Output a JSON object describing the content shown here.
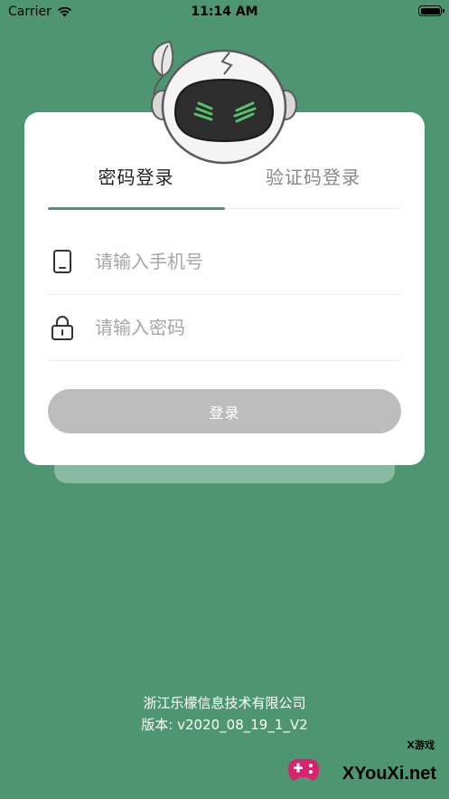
{
  "status_bar": {
    "carrier": "Carrier",
    "time": "11:14 AM"
  },
  "tabs": [
    {
      "label": "密码登录",
      "active": true
    },
    {
      "label": "验证码登录",
      "active": false
    }
  ],
  "fields": {
    "phone": {
      "placeholder": "请输入手机号",
      "value": ""
    },
    "password": {
      "placeholder": "请输入密码",
      "value": ""
    }
  },
  "login_button": {
    "label": "登录"
  },
  "footer": {
    "company": "浙江乐檬信息技术有限公司",
    "version": "版本: v2020_08_19_1_V2"
  },
  "watermark": {
    "badge": "X游戏",
    "text": "XYouXi.net"
  },
  "colors": {
    "background": "#4E9672",
    "accent": "#4E9672",
    "button_disabled": "#BDBDBD",
    "card": "#FFFFFF"
  },
  "icons": {
    "phone": "phone-outline-icon",
    "password": "lock-icon",
    "wifi": "wifi-icon",
    "battery": "battery-icon"
  }
}
